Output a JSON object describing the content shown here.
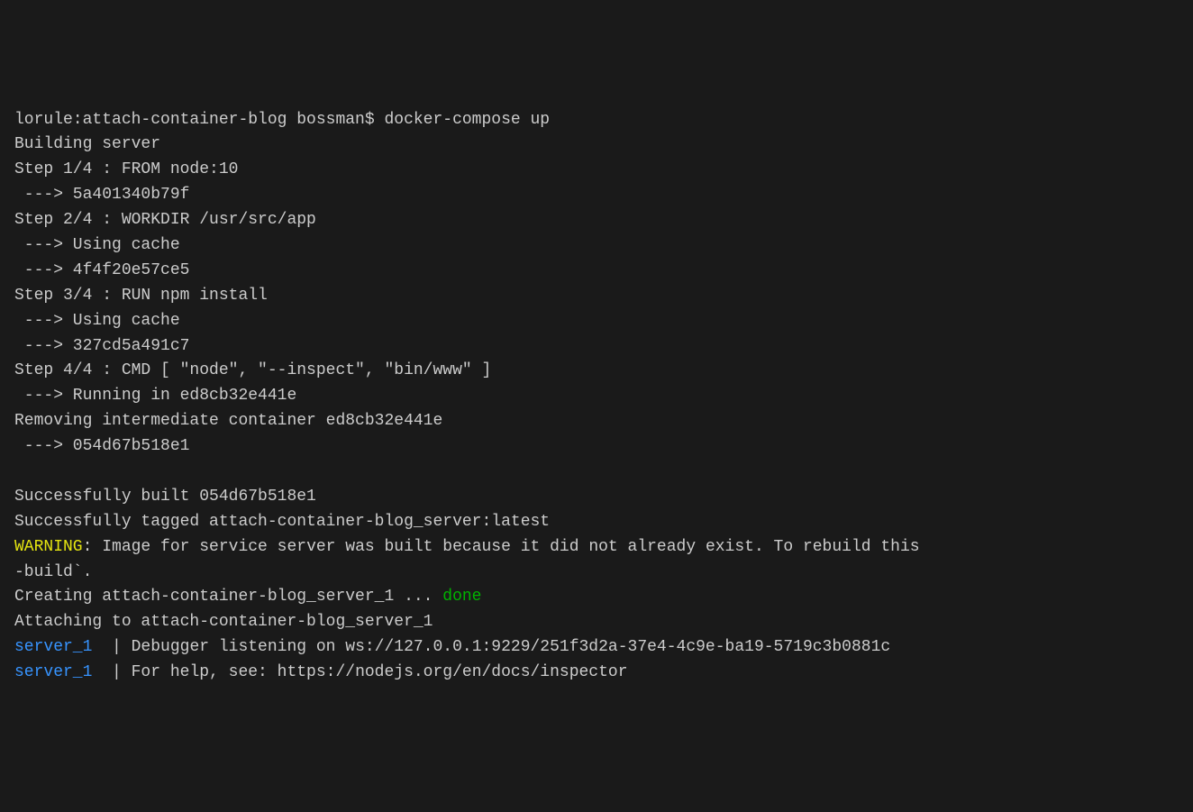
{
  "terminal": {
    "prompt": "lorule:attach-container-blog bossman$ ",
    "command": "docker-compose up",
    "lines": {
      "l1": "Building server",
      "l2": "Step 1/4 : FROM node:10",
      "l3": " ---> 5a401340b79f",
      "l4": "Step 2/4 : WORKDIR /usr/src/app",
      "l5": " ---> Using cache",
      "l6": " ---> 4f4f20e57ce5",
      "l7": "Step 3/4 : RUN npm install",
      "l8": " ---> Using cache",
      "l9": " ---> 327cd5a491c7",
      "l10": "Step 4/4 : CMD [ \"node\", \"--inspect\", \"bin/www\" ]",
      "l11": " ---> Running in ed8cb32e441e",
      "l12": "Removing intermediate container ed8cb32e441e",
      "l13": " ---> 054d67b518e1",
      "l14": "",
      "l15": "Successfully built 054d67b518e1",
      "l16": "Successfully tagged attach-container-blog_server:latest",
      "warning_label": "WARNING",
      "warning_text": ": Image for service server was built because it did not already exist. To rebuild this",
      "l18": "-build`.",
      "l19_pre": "Creating attach-container-blog_server_1 ... ",
      "l19_done": "done",
      "l20": "Attaching to attach-container-blog_server_1",
      "service_name": "server_1",
      "l21_text": "  | Debugger listening on ws://127.0.0.1:9229/251f3d2a-37e4-4c9e-ba19-5719c3b0881c",
      "l22_text": "  | For help, see: https://nodejs.org/en/docs/inspector"
    }
  }
}
